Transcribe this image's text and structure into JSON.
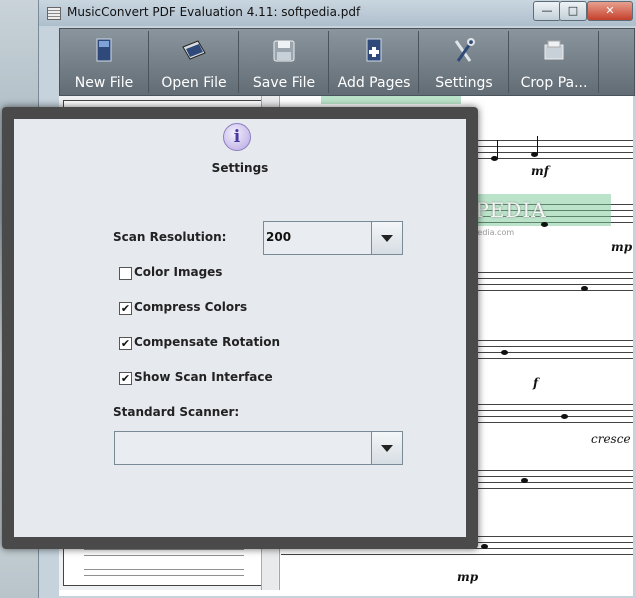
{
  "window": {
    "title": "MusicConvert PDF Evaluation 4.11: softpedia.pdf",
    "minimize_label": "—",
    "maximize_label": "□",
    "close_label": "✕"
  },
  "toolbar": {
    "buttons": [
      {
        "label": "New File",
        "icon": "new-file-icon"
      },
      {
        "label": "Open File",
        "icon": "open-file-icon"
      },
      {
        "label": "Save File",
        "icon": "save-file-icon"
      },
      {
        "label": "Add Pages",
        "icon": "add-pages-icon"
      },
      {
        "label": "Settings",
        "icon": "settings-icon"
      },
      {
        "label": "Crop Pa...",
        "icon": "crop-pages-icon"
      }
    ]
  },
  "score": {
    "dynamics": [
      "mf",
      "mp",
      "f",
      "cresce",
      "mp"
    ]
  },
  "watermark": {
    "text": "SOFTPEDIA",
    "sub": "www.softpedia.com"
  },
  "dialog": {
    "icon": "info-icon",
    "icon_glyph": "i",
    "title": "Settings",
    "scan_resolution_label": "Scan Resolution:",
    "scan_resolution_value": "200",
    "options": [
      {
        "label": "Color Images",
        "checked": false
      },
      {
        "label": "Compress Colors",
        "checked": true
      },
      {
        "label": "Compensate Rotation",
        "checked": true
      },
      {
        "label": "Show Scan Interface",
        "checked": true
      }
    ],
    "standard_scanner_label": "Standard Scanner:",
    "standard_scanner_value": ""
  }
}
